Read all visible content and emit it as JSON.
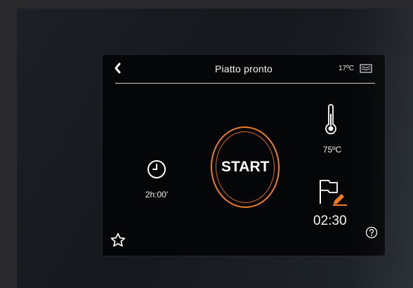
{
  "header": {
    "title": "Piatto pronto",
    "chamber_temp": "17ºC",
    "back_icon": "chevron-left-icon",
    "status_icon": "water-tray-icon"
  },
  "main": {
    "start_label": "START",
    "duration": "2h:00'",
    "core_temperature": "75ºC",
    "end_time": "02:30"
  },
  "icons": {
    "clock": "clock-icon",
    "thermometer": "thermometer-icon",
    "flag_edit": "flag-edit-icon",
    "help": "help-icon",
    "favorite": "star-icon"
  },
  "colors": {
    "accent": "#ee7d22",
    "screen_bg": "#050607",
    "text": "#eef0f2"
  }
}
